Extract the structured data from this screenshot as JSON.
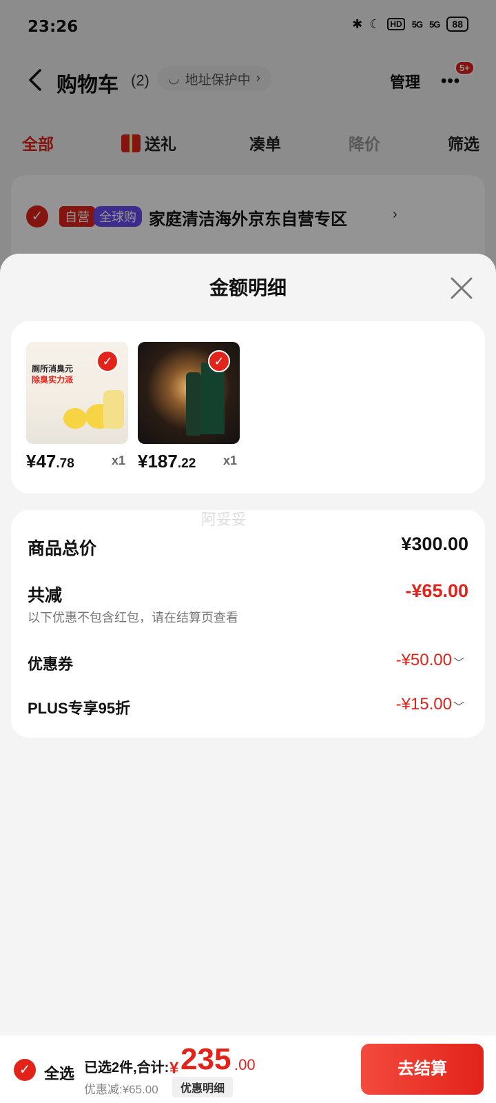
{
  "status_bar": {
    "time": "23:26",
    "network_1": "5G",
    "network_2": "5G",
    "hd": "HD",
    "battery": "88"
  },
  "nav": {
    "title": "购物车",
    "count": "(2)",
    "address_pill": "地址保护中",
    "manage": "管理",
    "more_badge": "5+"
  },
  "tabs": [
    "全部",
    "送礼",
    "凑单",
    "降价",
    "筛选"
  ],
  "store": {
    "tag_self": "自营",
    "tag_global": "全球购",
    "name": "家庭清洁海外京东自营专区"
  },
  "sheet": {
    "title": "金额明细",
    "products": [
      {
        "text_line1": "厕所消臭元",
        "text_line2": "除臭实力派",
        "price_int": "¥47",
        "price_dec": ".78",
        "qty": "x1"
      },
      {
        "price_int": "¥187",
        "price_dec": ".22",
        "qty": "x1"
      }
    ],
    "watermark": "阿妥妥",
    "summary": {
      "total_label": "商品总价",
      "total_value": "¥300.00",
      "reduce_label": "共减",
      "reduce_value": "-¥65.00",
      "note": "以下优惠不包含红包，请在结算页查看",
      "coupon_label": "优惠券",
      "coupon_value": "-¥50.00",
      "plus_label": "PLUS专享95折",
      "plus_value": "-¥15.00"
    }
  },
  "bottom": {
    "select_all": "全选",
    "selected_text": "已选2件,合计:",
    "currency": "¥",
    "total_int": "235",
    "total_dec": ".00",
    "discount_text": "优惠减:¥65.00",
    "detail_button": "优惠明细",
    "checkout": "去结算"
  },
  "colors": {
    "accent": "#e2231a",
    "purple_tag": "#6a4df0"
  }
}
